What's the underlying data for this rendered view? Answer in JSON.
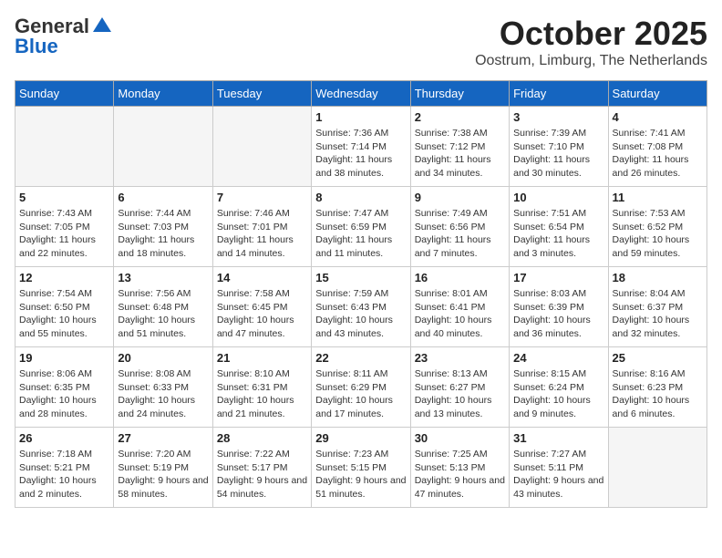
{
  "header": {
    "logo": {
      "general": "General",
      "blue": "Blue"
    },
    "month": "October 2025",
    "location": "Oostrum, Limburg, The Netherlands"
  },
  "weekdays": [
    "Sunday",
    "Monday",
    "Tuesday",
    "Wednesday",
    "Thursday",
    "Friday",
    "Saturday"
  ],
  "weeks": [
    [
      {
        "day": "",
        "info": ""
      },
      {
        "day": "",
        "info": ""
      },
      {
        "day": "",
        "info": ""
      },
      {
        "day": "1",
        "info": "Sunrise: 7:36 AM\nSunset: 7:14 PM\nDaylight: 11 hours and 38 minutes."
      },
      {
        "day": "2",
        "info": "Sunrise: 7:38 AM\nSunset: 7:12 PM\nDaylight: 11 hours and 34 minutes."
      },
      {
        "day": "3",
        "info": "Sunrise: 7:39 AM\nSunset: 7:10 PM\nDaylight: 11 hours and 30 minutes."
      },
      {
        "day": "4",
        "info": "Sunrise: 7:41 AM\nSunset: 7:08 PM\nDaylight: 11 hours and 26 minutes."
      }
    ],
    [
      {
        "day": "5",
        "info": "Sunrise: 7:43 AM\nSunset: 7:05 PM\nDaylight: 11 hours and 22 minutes."
      },
      {
        "day": "6",
        "info": "Sunrise: 7:44 AM\nSunset: 7:03 PM\nDaylight: 11 hours and 18 minutes."
      },
      {
        "day": "7",
        "info": "Sunrise: 7:46 AM\nSunset: 7:01 PM\nDaylight: 11 hours and 14 minutes."
      },
      {
        "day": "8",
        "info": "Sunrise: 7:47 AM\nSunset: 6:59 PM\nDaylight: 11 hours and 11 minutes."
      },
      {
        "day": "9",
        "info": "Sunrise: 7:49 AM\nSunset: 6:56 PM\nDaylight: 11 hours and 7 minutes."
      },
      {
        "day": "10",
        "info": "Sunrise: 7:51 AM\nSunset: 6:54 PM\nDaylight: 11 hours and 3 minutes."
      },
      {
        "day": "11",
        "info": "Sunrise: 7:53 AM\nSunset: 6:52 PM\nDaylight: 10 hours and 59 minutes."
      }
    ],
    [
      {
        "day": "12",
        "info": "Sunrise: 7:54 AM\nSunset: 6:50 PM\nDaylight: 10 hours and 55 minutes."
      },
      {
        "day": "13",
        "info": "Sunrise: 7:56 AM\nSunset: 6:48 PM\nDaylight: 10 hours and 51 minutes."
      },
      {
        "day": "14",
        "info": "Sunrise: 7:58 AM\nSunset: 6:45 PM\nDaylight: 10 hours and 47 minutes."
      },
      {
        "day": "15",
        "info": "Sunrise: 7:59 AM\nSunset: 6:43 PM\nDaylight: 10 hours and 43 minutes."
      },
      {
        "day": "16",
        "info": "Sunrise: 8:01 AM\nSunset: 6:41 PM\nDaylight: 10 hours and 40 minutes."
      },
      {
        "day": "17",
        "info": "Sunrise: 8:03 AM\nSunset: 6:39 PM\nDaylight: 10 hours and 36 minutes."
      },
      {
        "day": "18",
        "info": "Sunrise: 8:04 AM\nSunset: 6:37 PM\nDaylight: 10 hours and 32 minutes."
      }
    ],
    [
      {
        "day": "19",
        "info": "Sunrise: 8:06 AM\nSunset: 6:35 PM\nDaylight: 10 hours and 28 minutes."
      },
      {
        "day": "20",
        "info": "Sunrise: 8:08 AM\nSunset: 6:33 PM\nDaylight: 10 hours and 24 minutes."
      },
      {
        "day": "21",
        "info": "Sunrise: 8:10 AM\nSunset: 6:31 PM\nDaylight: 10 hours and 21 minutes."
      },
      {
        "day": "22",
        "info": "Sunrise: 8:11 AM\nSunset: 6:29 PM\nDaylight: 10 hours and 17 minutes."
      },
      {
        "day": "23",
        "info": "Sunrise: 8:13 AM\nSunset: 6:27 PM\nDaylight: 10 hours and 13 minutes."
      },
      {
        "day": "24",
        "info": "Sunrise: 8:15 AM\nSunset: 6:24 PM\nDaylight: 10 hours and 9 minutes."
      },
      {
        "day": "25",
        "info": "Sunrise: 8:16 AM\nSunset: 6:23 PM\nDaylight: 10 hours and 6 minutes."
      }
    ],
    [
      {
        "day": "26",
        "info": "Sunrise: 7:18 AM\nSunset: 5:21 PM\nDaylight: 10 hours and 2 minutes."
      },
      {
        "day": "27",
        "info": "Sunrise: 7:20 AM\nSunset: 5:19 PM\nDaylight: 9 hours and 58 minutes."
      },
      {
        "day": "28",
        "info": "Sunrise: 7:22 AM\nSunset: 5:17 PM\nDaylight: 9 hours and 54 minutes."
      },
      {
        "day": "29",
        "info": "Sunrise: 7:23 AM\nSunset: 5:15 PM\nDaylight: 9 hours and 51 minutes."
      },
      {
        "day": "30",
        "info": "Sunrise: 7:25 AM\nSunset: 5:13 PM\nDaylight: 9 hours and 47 minutes."
      },
      {
        "day": "31",
        "info": "Sunrise: 7:27 AM\nSunset: 5:11 PM\nDaylight: 9 hours and 43 minutes."
      },
      {
        "day": "",
        "info": ""
      }
    ]
  ]
}
